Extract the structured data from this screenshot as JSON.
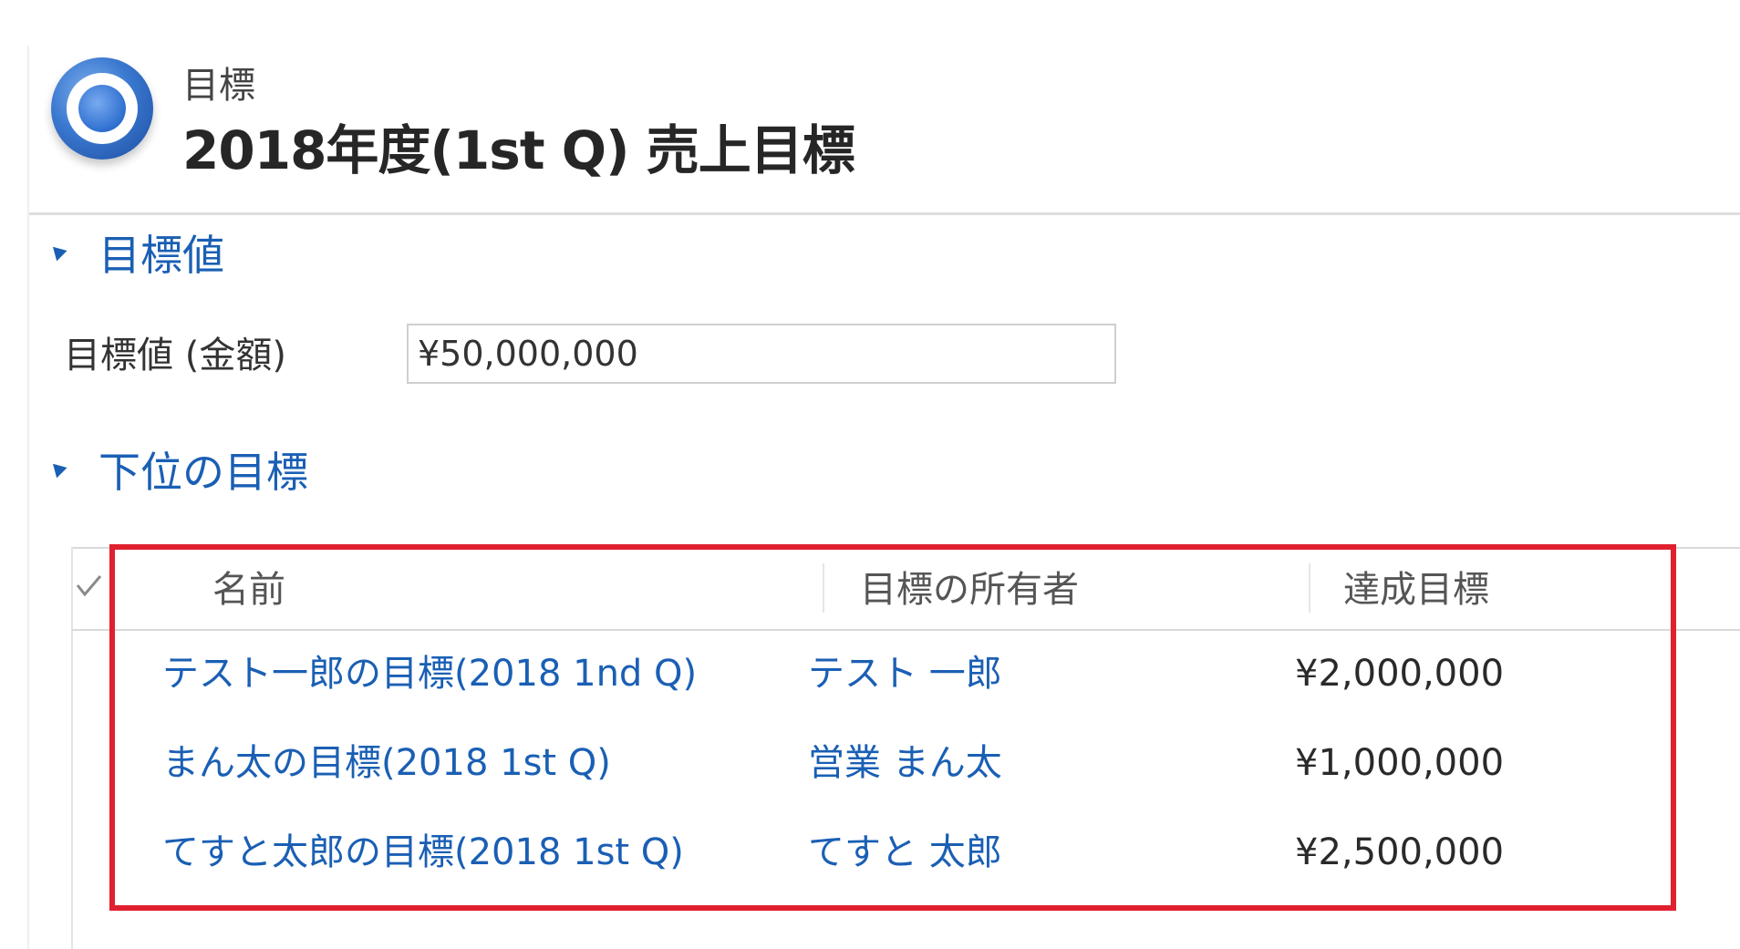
{
  "header": {
    "entity_type": "目標",
    "record_title": "2018年度(1st Q) 売上目標",
    "icon": "goal-target-icon"
  },
  "target_section": {
    "title": "目標値",
    "field_label": "目標値 (金額)",
    "field_value": "¥50,000,000"
  },
  "child_goals_section": {
    "title": "下位の目標",
    "columns": [
      "名前",
      "目標の所有者",
      "達成目標"
    ],
    "rows": [
      {
        "name": "テスト一郎の目標(2018 1nd Q)",
        "owner": "テスト 一郎",
        "target": "¥2,000,000"
      },
      {
        "name": "まん太の目標(2018 1st Q)",
        "owner": "営業 まん太",
        "target": "¥1,000,000"
      },
      {
        "name": "てすと太郎の目標(2018 1st Q)",
        "owner": "てすと 太郎",
        "target": "¥2,500,000"
      }
    ]
  },
  "annotation": {
    "highlight_color": "#e0202f"
  },
  "colors": {
    "link": "#1a5fb4",
    "accent_blue": "#3a78d0"
  }
}
